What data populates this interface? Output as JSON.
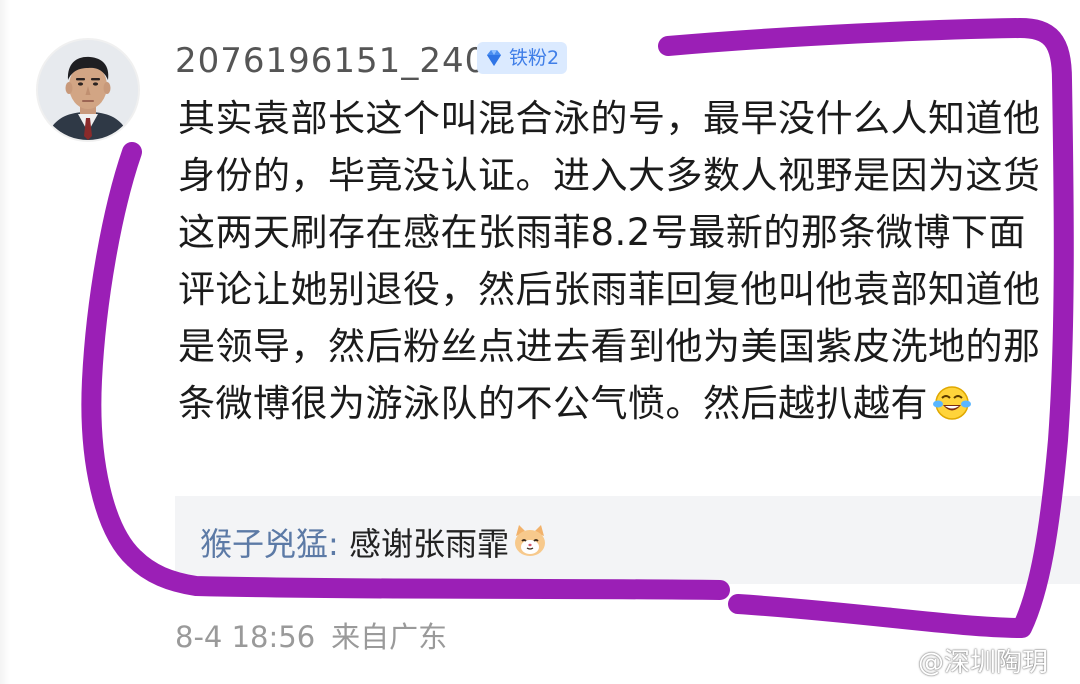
{
  "comment": {
    "username": "2076196151_240",
    "badge": {
      "icon": "diamond-icon",
      "label": "铁粉2",
      "color": "#3f7ee8",
      "background": "#dbeaff"
    },
    "body": "其实袁部长这个叫混合泳的号，最早没什么人知道他身份的，毕竟没认证。进入大多数人视野是因为这货这两天刷存在感在张雨菲8.2号最新的那条微博下面评论让她别退役，然后张雨菲回复他叫他袁部知道他是领导，然后粉丝点进去看到他为美国紫皮洗地的那条微博很为游泳队的不公气愤。然后越扒越有",
    "body_emoji": "laugh-cry-emoji",
    "reply": {
      "name": "猴子兇猛",
      "colon": ":",
      "text": " 感谢张雨霏",
      "emoji": "cat-emoji"
    },
    "meta": {
      "time": "8-4 18:56",
      "location": "来自广东"
    }
  },
  "watermark": {
    "icon": "weibo-logo-icon",
    "text": "@深圳陶玥"
  },
  "annotation": {
    "color": "#9b1fb6"
  }
}
